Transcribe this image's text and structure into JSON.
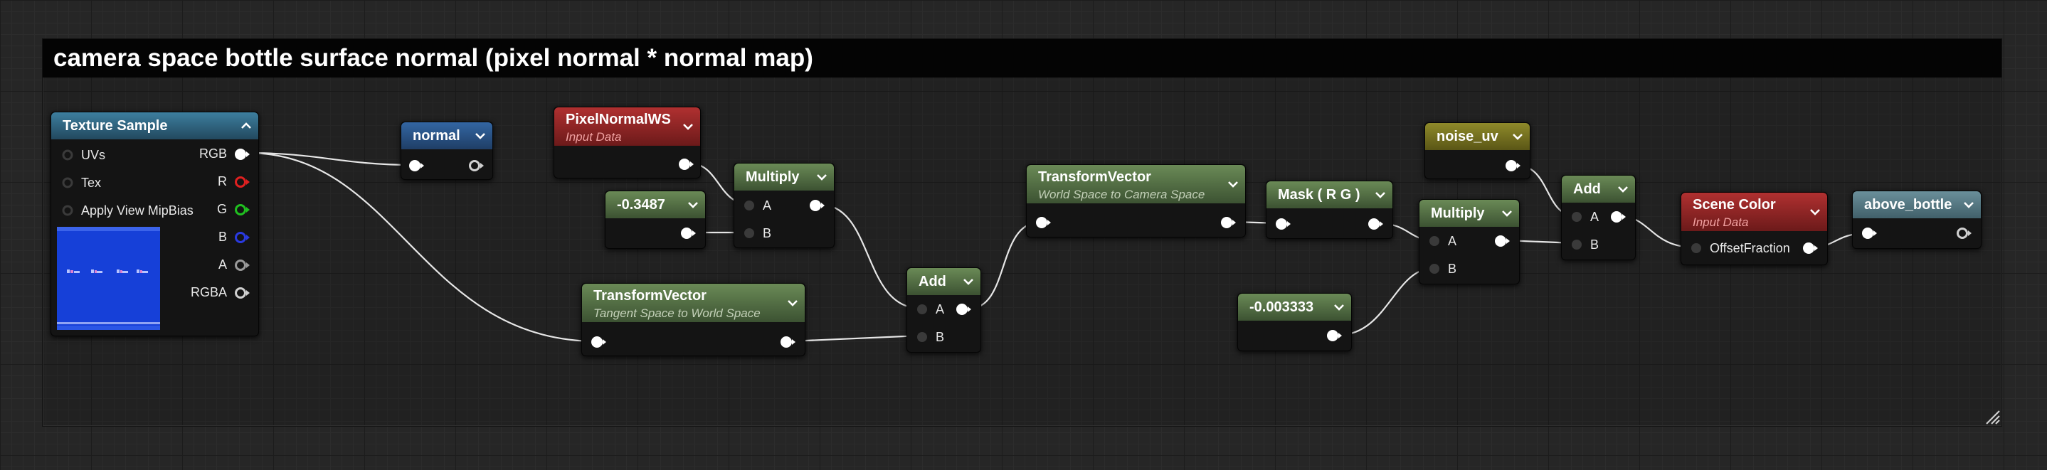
{
  "comment": {
    "title": "camera space bottle surface normal (pixel normal * normal map)"
  },
  "texture_sample": {
    "title": "Texture Sample",
    "inputs": [
      "UVs",
      "Tex",
      "Apply View MipBias"
    ],
    "outputs": [
      "RGB",
      "R",
      "G",
      "B",
      "A",
      "RGBA"
    ],
    "preview_icon": "normal-map-texture-thumbnail"
  },
  "normal_param": {
    "title": "normal"
  },
  "pixel_normal_ws": {
    "title": "PixelNormalWS",
    "subtitle": "Input Data"
  },
  "const_a": {
    "title": "-0.3487"
  },
  "multiply_1": {
    "title": "Multiply",
    "pin_a": "A",
    "pin_b": "B"
  },
  "transform_tangent": {
    "title": "TransformVector",
    "subtitle": "Tangent Space to World Space"
  },
  "add_1": {
    "title": "Add",
    "pin_a": "A",
    "pin_b": "B"
  },
  "transform_camera": {
    "title": "TransformVector",
    "subtitle": "World Space to Camera Space"
  },
  "mask": {
    "title": "Mask ( R G )"
  },
  "const_b": {
    "title": "-0.003333"
  },
  "multiply_2": {
    "title": "Multiply",
    "pin_a": "A",
    "pin_b": "B"
  },
  "noise_uv": {
    "title": "noise_uv"
  },
  "add_2": {
    "title": "Add",
    "pin_a": "A",
    "pin_b": "B"
  },
  "scene_color": {
    "title": "Scene Color",
    "subtitle": "Input Data",
    "pin_in": "OffsetFraction"
  },
  "above_bottle": {
    "title": "above_bottle"
  },
  "colors": {
    "teal_header": "#3d7f9f",
    "blue_header": "#3366a3",
    "red_header": "#b03030",
    "green_header": "#6a8a56",
    "olive_header": "#8f8a2a",
    "slate_header": "#6a8f9a",
    "wire": "#e6e6e6",
    "pin_r": "#e02020",
    "pin_g": "#20c020",
    "pin_b": "#2a3ae0",
    "pin_a": "#9a9a9a",
    "thumbnail": "#1640d8"
  }
}
